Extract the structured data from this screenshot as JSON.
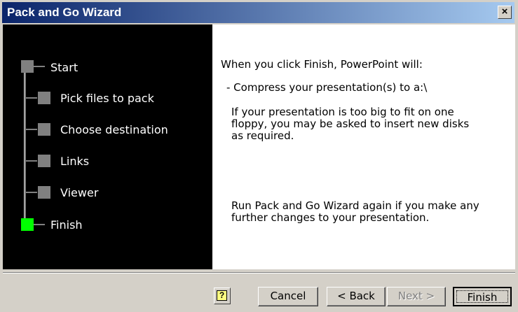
{
  "window": {
    "title": "Pack and Go Wizard",
    "close_label": "×"
  },
  "steps": [
    {
      "label": "Start",
      "active": false
    },
    {
      "label": "Pick files to pack",
      "active": false
    },
    {
      "label": "Choose destination",
      "active": false
    },
    {
      "label": "Links",
      "active": false
    },
    {
      "label": "Viewer",
      "active": false
    },
    {
      "label": "Finish",
      "active": true
    }
  ],
  "content": {
    "line1": "When you click Finish, PowerPoint will:",
    "line2": "- Compress your presentation(s) to a:\\",
    "para1": "If your presentation is too big to fit on one floppy, you may be asked to insert new disks as required.",
    "para2": "Run Pack and Go Wizard again if you make any further changes to your presentation."
  },
  "buttons": {
    "help": "?",
    "cancel": "Cancel",
    "back": "< Back",
    "next": "Next >",
    "finish": "Finish"
  },
  "colors": {
    "active_step": "#00ff00",
    "title_start": "#0a246a",
    "title_end": "#a6caf0"
  }
}
